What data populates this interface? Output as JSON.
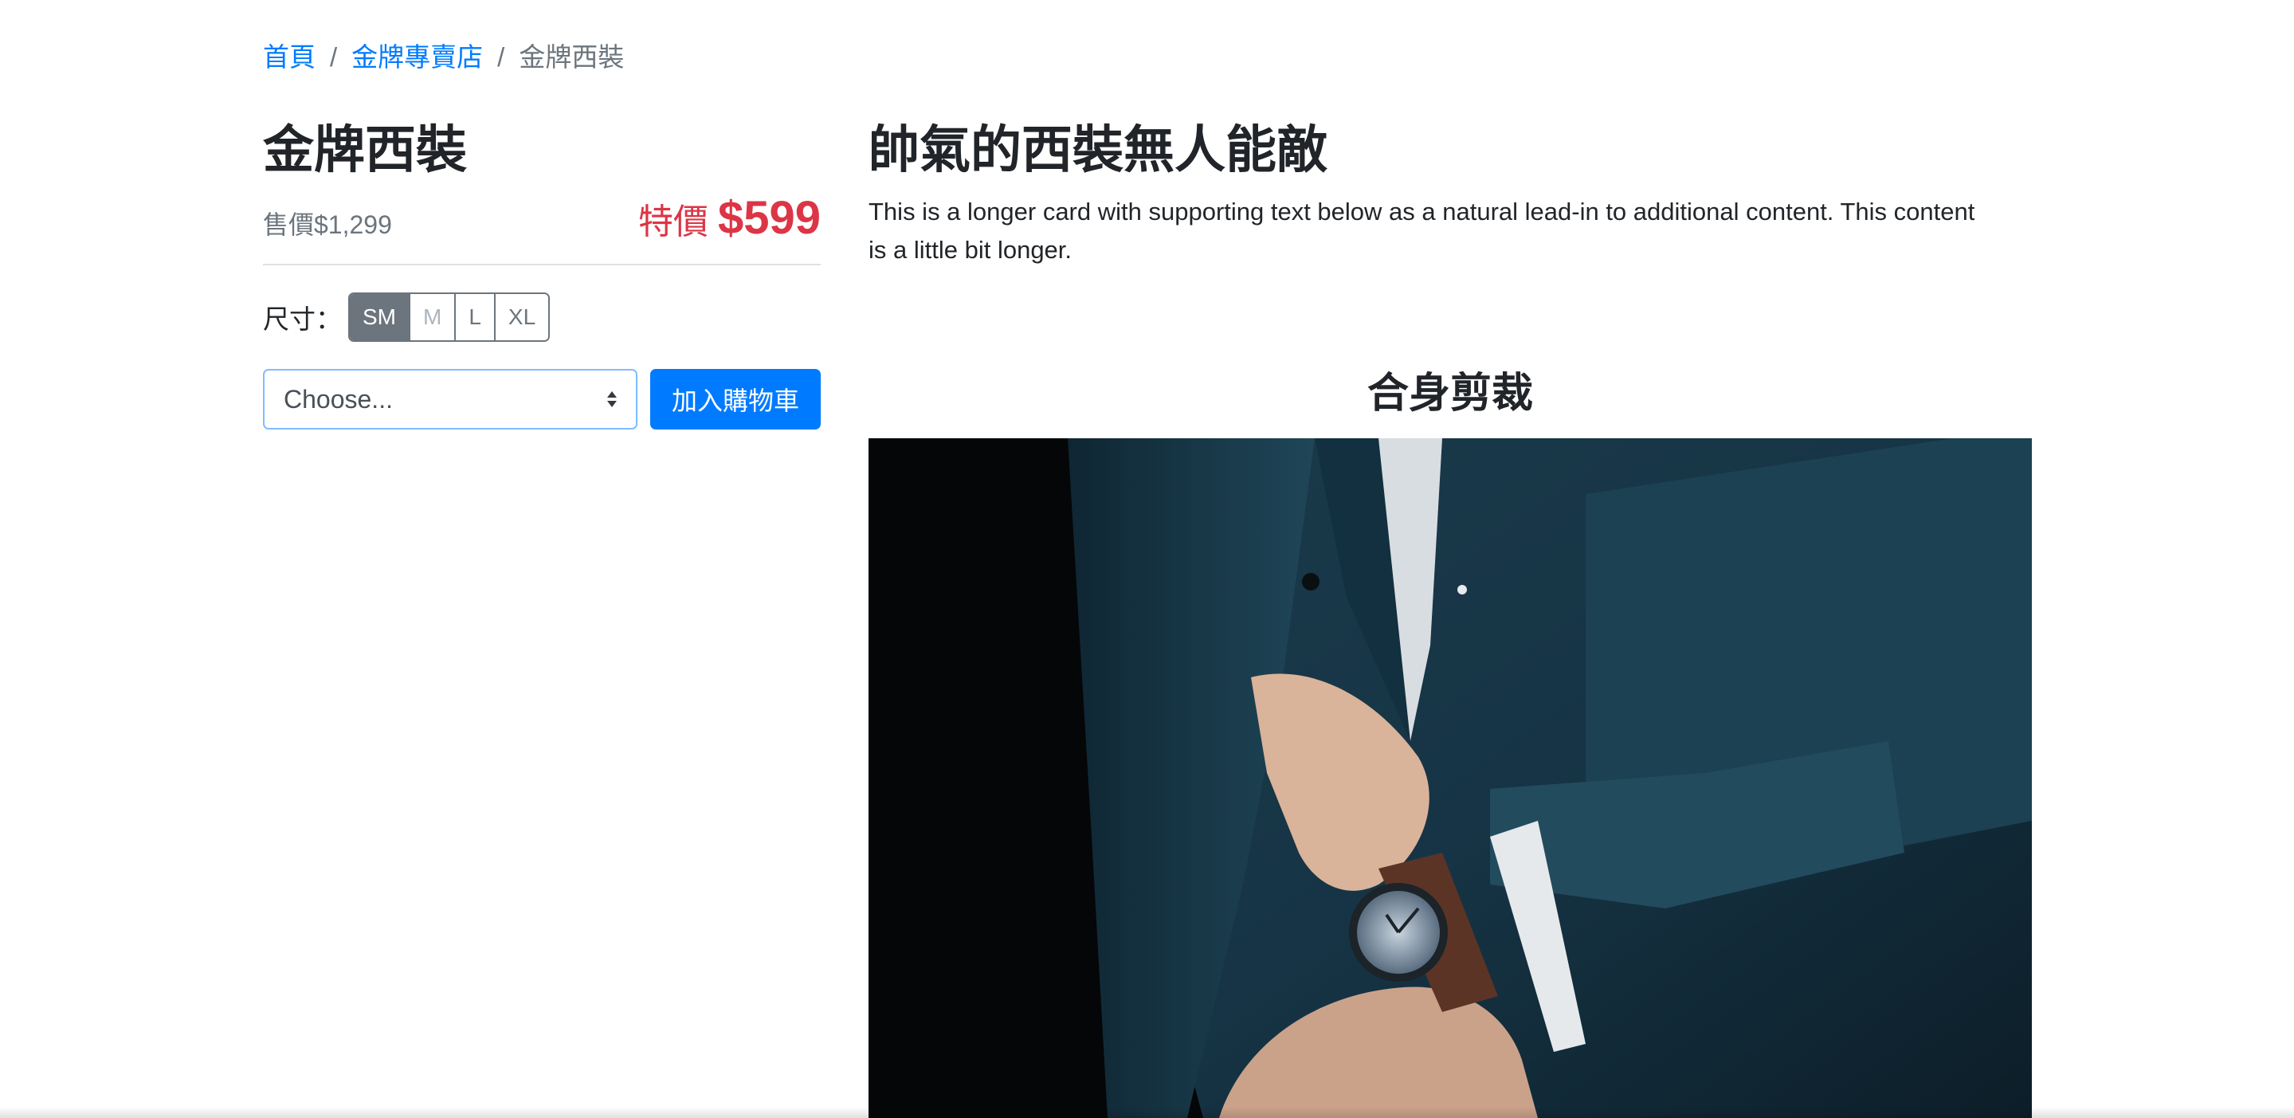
{
  "breadcrumb": {
    "home": "首頁",
    "store": "金牌專賣店",
    "current": "金牌西裝"
  },
  "product": {
    "title": "金牌西裝",
    "original_price": "售價$1,299",
    "sale_label": "特價",
    "sale_amount": "$599",
    "size_label": "尺寸：",
    "sizes": [
      "SM",
      "M",
      "L",
      "XL"
    ],
    "selected_size": "SM",
    "select_placeholder": "Choose...",
    "add_to_cart": "加入購物車"
  },
  "content": {
    "headline": "帥氣的西裝無人能敵",
    "lead": "This is a longer card with supporting text below as a natural lead-in to additional content. This content is a little bit longer.",
    "feature_title": "合身剪裁"
  },
  "colors": {
    "primary": "#007bff",
    "danger": "#dc3545",
    "secondary": "#6c757d"
  }
}
